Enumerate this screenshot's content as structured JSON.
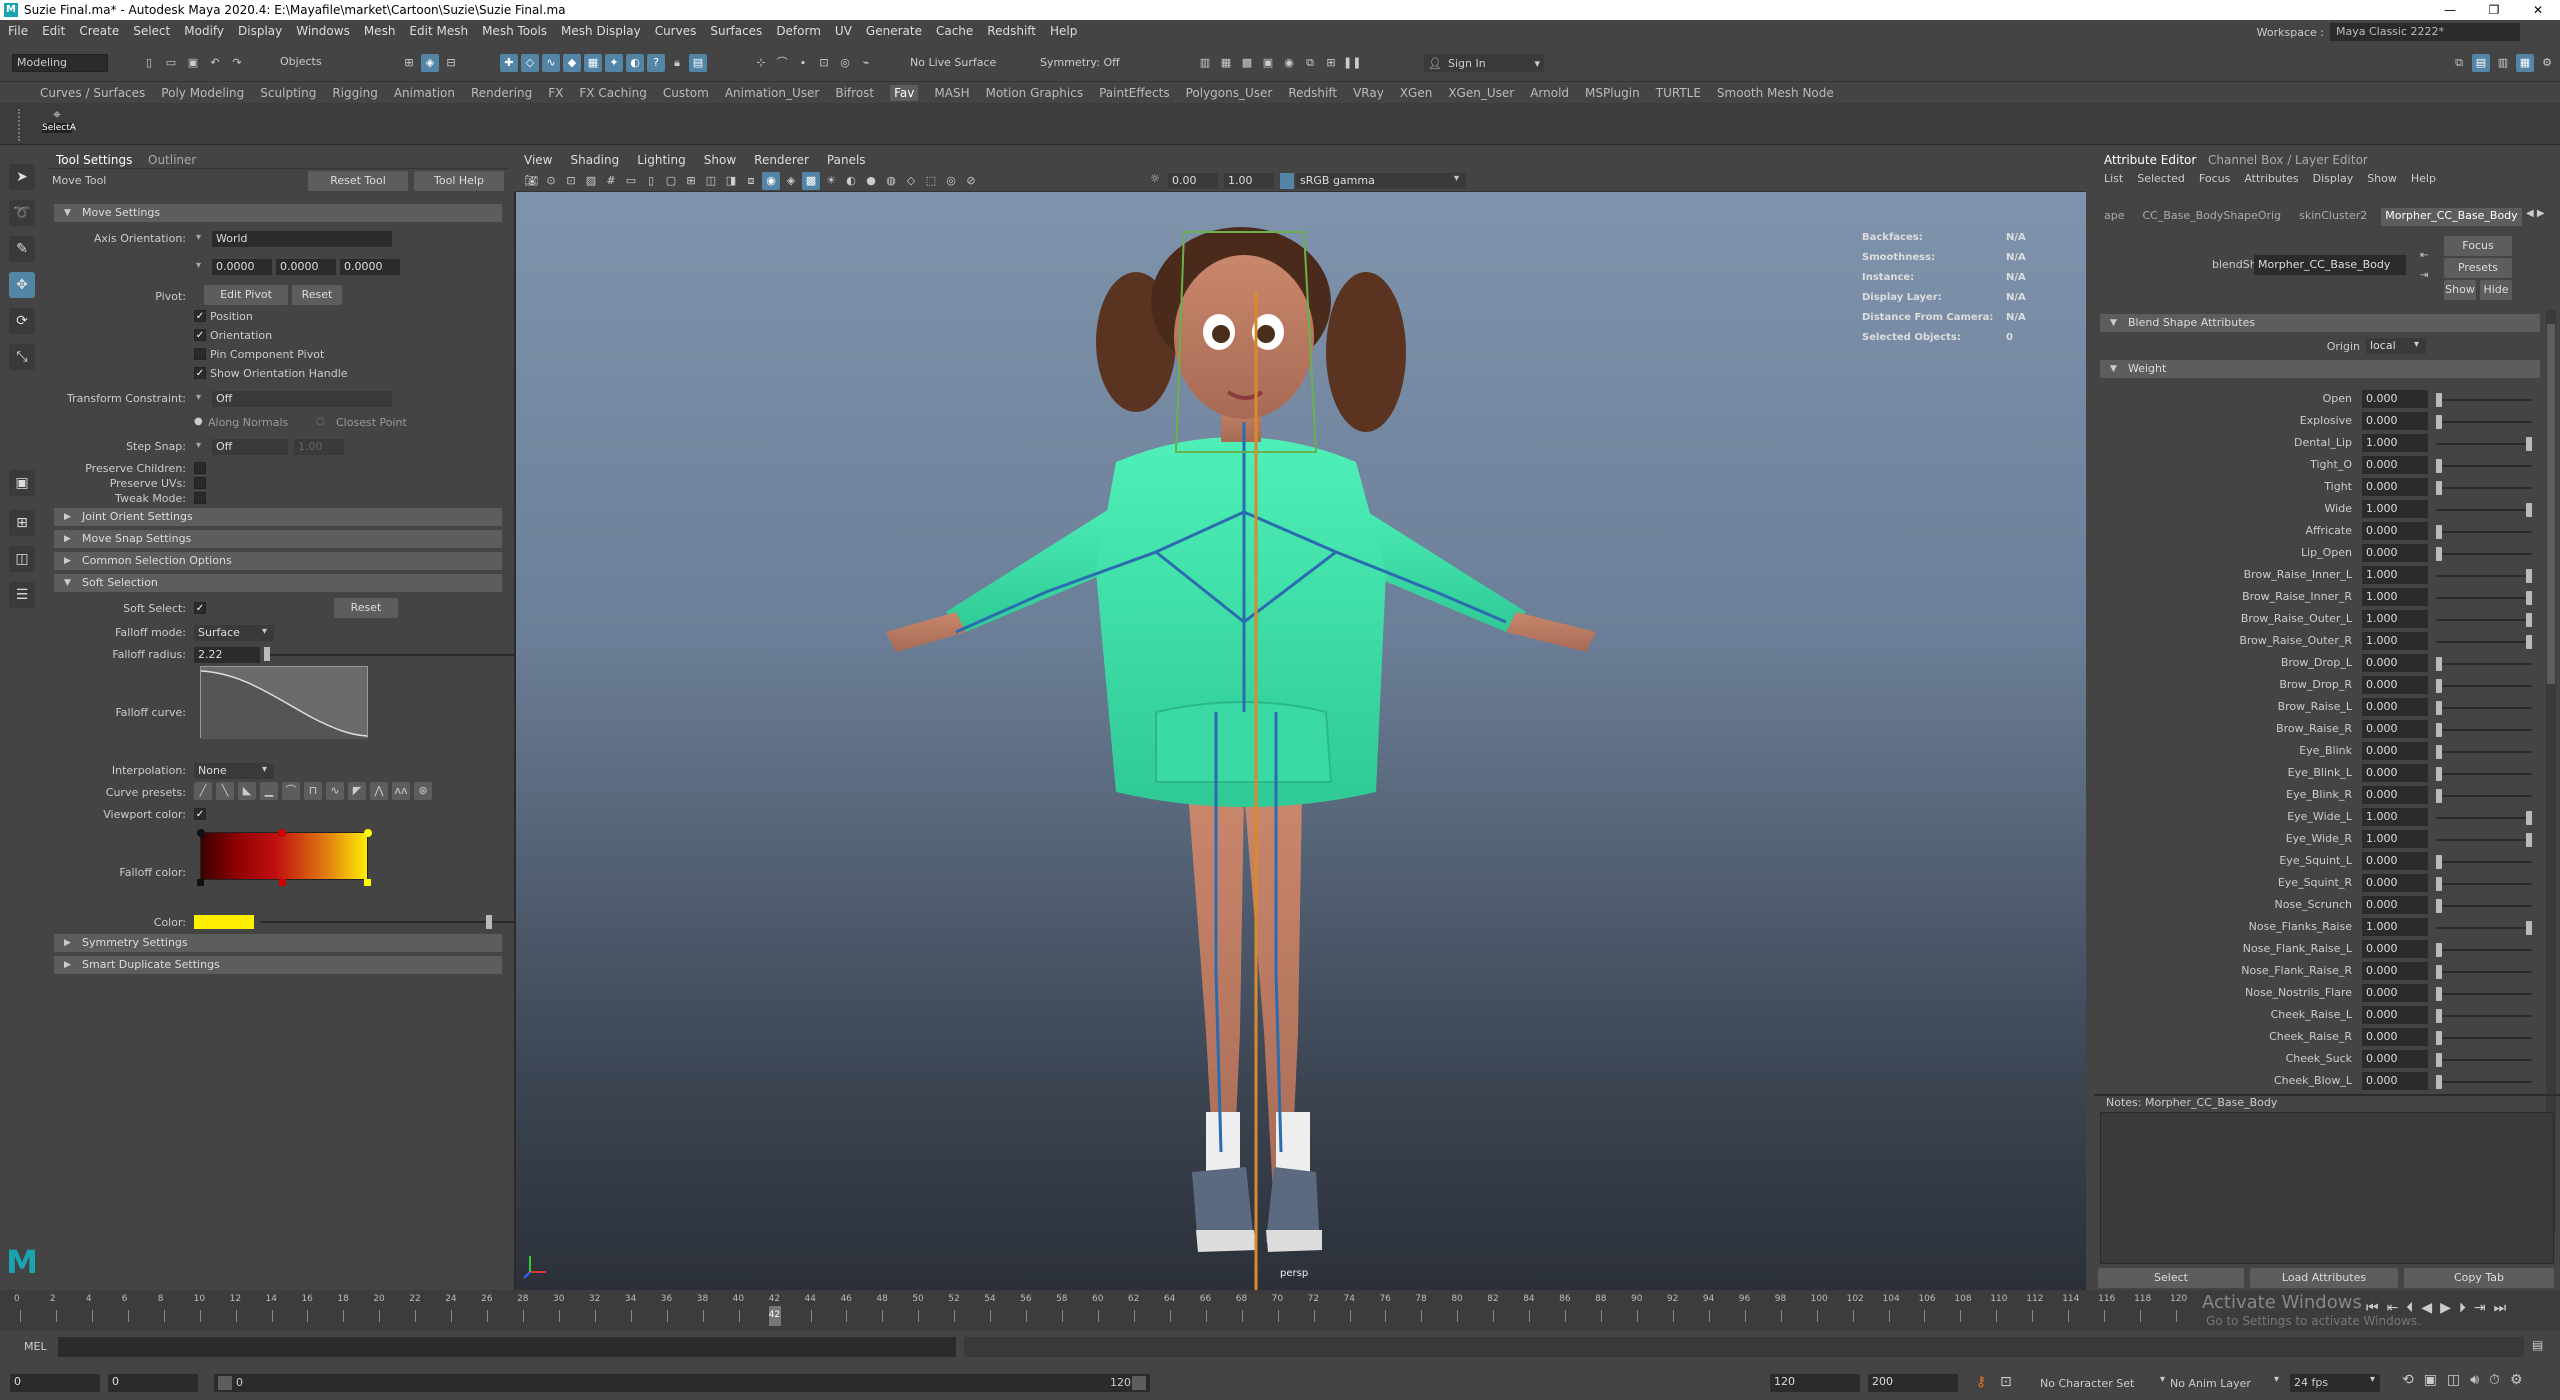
{
  "titlebar": {
    "title": "Suzie Final.ma* - Autodesk Maya 2020.4: E:\\Mayafile\\market\\Cartoon\\Suzie\\Suzie Final.ma",
    "minimize": "—",
    "maximize": "❐",
    "close": "✕"
  },
  "menus": [
    "File",
    "Edit",
    "Create",
    "Select",
    "Modify",
    "Display",
    "Windows",
    "Mesh",
    "Edit Mesh",
    "Mesh Tools",
    "Mesh Display",
    "Curves",
    "Surfaces",
    "Deform",
    "UV",
    "Generate",
    "Cache",
    "Redshift",
    "Help"
  ],
  "workspace": {
    "label": "Workspace :",
    "value": "Maya Classic 2222*"
  },
  "statusline": {
    "mode": "Modeling",
    "objects": "Objects",
    "live_surface": "No Live Surface",
    "symmetry": "Symmetry: Off",
    "sign_in": "Sign In"
  },
  "shelf_tabs": [
    "Curves / Surfaces",
    "Poly Modeling",
    "Sculpting",
    "Rigging",
    "Animation",
    "Rendering",
    "FX",
    "FX Caching",
    "Custom",
    "Animation_User",
    "Bifrost",
    "Fav",
    "MASH",
    "Motion Graphics",
    "PaintEffects",
    "Polygons_User",
    "Redshift",
    "VRay",
    "XGen",
    "XGen_User",
    "Arnold",
    "MSPlugin",
    "TURTLE",
    "Smooth Mesh Node"
  ],
  "shelf_active": "Fav",
  "shelf_item": "SelectA",
  "toolpanel": {
    "tabs": [
      "Tool Settings",
      "Outliner"
    ],
    "tool_name": "Move Tool",
    "reset_tool": "Reset Tool",
    "tool_help": "Tool Help",
    "move_settings": "Move Settings",
    "axis_orientation_label": "Axis Orientation:",
    "axis_orientation": "World",
    "axis_values": [
      "0.0000",
      "0.0000",
      "0.0000"
    ],
    "pivot_label": "Pivot:",
    "edit_pivot": "Edit Pivot",
    "reset": "Reset",
    "position": "Position",
    "orientation": "Orientation",
    "pin_component_pivot": "Pin Component Pivot",
    "show_orientation_handle": "Show Orientation Handle",
    "transform_constraint_label": "Transform Constraint:",
    "transform_constraint": "Off",
    "along_normals": "Along Normals",
    "closest_point": "Closest Point",
    "step_snap_label": "Step Snap:",
    "step_snap": "Off",
    "step_snap_value": "1.00",
    "preserve_children": "Preserve Children:",
    "preserve_uvs": "Preserve UVs:",
    "tweak_mode": "Tweak Mode:",
    "joint_orient_settings": "Joint Orient Settings",
    "move_snap_settings": "Move Snap Settings",
    "common_selection_options": "Common Selection Options",
    "soft_selection": "Soft Selection",
    "soft_select_label": "Soft Select:",
    "soft_reset": "Reset",
    "falloff_mode_label": "Falloff mode:",
    "falloff_mode": "Surface",
    "falloff_radius_label": "Falloff radius:",
    "falloff_radius": "2.22",
    "falloff_curve_label": "Falloff curve:",
    "interpolation_label": "Interpolation:",
    "interpolation": "None",
    "curve_presets_label": "Curve presets:",
    "viewport_color_label": "Viewport color:",
    "falloff_color_label": "Falloff color:",
    "color_label": "Color:",
    "symmetry_settings": "Symmetry Settings",
    "smart_duplicate_settings": "Smart Duplicate Settings"
  },
  "viewport": {
    "menus": [
      "View",
      "Shading",
      "Lighting",
      "Show",
      "Renderer",
      "Panels"
    ],
    "exposure": "0.00",
    "gamma": "1.00",
    "color_space": "sRGB gamma",
    "camera": "persp",
    "hud": [
      {
        "k": "Backfaces:",
        "v": "N/A"
      },
      {
        "k": "Smoothness:",
        "v": "N/A"
      },
      {
        "k": "Instance:",
        "v": "N/A"
      },
      {
        "k": "Display Layer:",
        "v": "N/A"
      },
      {
        "k": "Distance From Camera:",
        "v": "N/A"
      },
      {
        "k": "Selected Objects:",
        "v": "0"
      }
    ]
  },
  "attr": {
    "tabs": [
      "Attribute Editor",
      "Channel Box / Layer Editor"
    ],
    "menus": [
      "List",
      "Selected",
      "Focus",
      "Attributes",
      "Display",
      "Show",
      "Help"
    ],
    "node_tabs": [
      "ape",
      "CC_Base_BodyShapeOrig",
      "skinCluster2",
      "Morpher_CC_Base_Body"
    ],
    "blendshape_label": "blendShape:",
    "blendshape": "Morpher_CC_Base_Body",
    "focus": "Focus",
    "presets": "Presets",
    "show": "Show",
    "hide": "Hide",
    "blend_shape_attributes": "Blend Shape Attributes",
    "origin_label": "Origin",
    "origin": "local",
    "weight": "Weight",
    "weights": [
      {
        "n": "Open",
        "v": "0.000",
        "f": 0
      },
      {
        "n": "Explosive",
        "v": "0.000",
        "f": 0
      },
      {
        "n": "Dental_Lip",
        "v": "1.000",
        "f": 1
      },
      {
        "n": "Tight_O",
        "v": "0.000",
        "f": 0
      },
      {
        "n": "Tight",
        "v": "0.000",
        "f": 0
      },
      {
        "n": "Wide",
        "v": "1.000",
        "f": 1
      },
      {
        "n": "Affricate",
        "v": "0.000",
        "f": 0
      },
      {
        "n": "Lip_Open",
        "v": "0.000",
        "f": 0
      },
      {
        "n": "Brow_Raise_Inner_L",
        "v": "1.000",
        "f": 1
      },
      {
        "n": "Brow_Raise_Inner_R",
        "v": "1.000",
        "f": 1
      },
      {
        "n": "Brow_Raise_Outer_L",
        "v": "1.000",
        "f": 1
      },
      {
        "n": "Brow_Raise_Outer_R",
        "v": "1.000",
        "f": 1
      },
      {
        "n": "Brow_Drop_L",
        "v": "0.000",
        "f": 0
      },
      {
        "n": "Brow_Drop_R",
        "v": "0.000",
        "f": 0
      },
      {
        "n": "Brow_Raise_L",
        "v": "0.000",
        "f": 0
      },
      {
        "n": "Brow_Raise_R",
        "v": "0.000",
        "f": 0
      },
      {
        "n": "Eye_Blink",
        "v": "0.000",
        "f": 0
      },
      {
        "n": "Eye_Blink_L",
        "v": "0.000",
        "f": 0
      },
      {
        "n": "Eye_Blink_R",
        "v": "0.000",
        "f": 0
      },
      {
        "n": "Eye_Wide_L",
        "v": "1.000",
        "f": 1
      },
      {
        "n": "Eye_Wide_R",
        "v": "1.000",
        "f": 1
      },
      {
        "n": "Eye_Squint_L",
        "v": "0.000",
        "f": 0
      },
      {
        "n": "Eye_Squint_R",
        "v": "0.000",
        "f": 0
      },
      {
        "n": "Nose_Scrunch",
        "v": "0.000",
        "f": 0
      },
      {
        "n": "Nose_Flanks_Raise",
        "v": "1.000",
        "f": 1
      },
      {
        "n": "Nose_Flank_Raise_L",
        "v": "0.000",
        "f": 0
      },
      {
        "n": "Nose_Flank_Raise_R",
        "v": "0.000",
        "f": 0
      },
      {
        "n": "Nose_Nostrils_Flare",
        "v": "0.000",
        "f": 0
      },
      {
        "n": "Cheek_Raise_L",
        "v": "0.000",
        "f": 0
      },
      {
        "n": "Cheek_Raise_R",
        "v": "0.000",
        "f": 0
      },
      {
        "n": "Cheek_Suck",
        "v": "0.000",
        "f": 0
      },
      {
        "n": "Cheek_Blow_L",
        "v": "0.000",
        "f": 0
      }
    ],
    "notes": "Notes:  Morpher_CC_Base_Body",
    "select": "Select",
    "load_attributes": "Load Attributes",
    "copy_tab": "Copy Tab"
  },
  "timeline": {
    "ticks": [
      "0",
      "2",
      "4",
      "6",
      "8",
      "10",
      "12",
      "14",
      "16",
      "18",
      "20",
      "22",
      "24",
      "26",
      "28",
      "30",
      "32",
      "34",
      "36",
      "38",
      "40",
      "42",
      "44",
      "46",
      "48",
      "50",
      "52",
      "54",
      "56",
      "58",
      "60",
      "62",
      "64",
      "66",
      "68",
      "70",
      "72",
      "74",
      "76",
      "78",
      "80",
      "82",
      "84",
      "86",
      "88",
      "90",
      "92",
      "94",
      "96",
      "98",
      "100",
      "102",
      "104",
      "106",
      "108",
      "110",
      "112",
      "114",
      "116",
      "118",
      "120"
    ],
    "current": "42",
    "activate_windows": "Activate Windows",
    "activate_sub": "Go to Settings to activate Windows."
  },
  "cmdline": {
    "label": "MEL"
  },
  "rangebar": {
    "start": "0",
    "start2": "0",
    "range_start": "0",
    "range_end": "120",
    "end": "120",
    "end2": "200",
    "character_set": "No Character Set",
    "anim_layer": "No Anim Layer",
    "fps": "24 fps"
  },
  "colors": {
    "accent": "#5285a6",
    "hoodie": "#3ddba8",
    "falloff_yellow": "#ffee00",
    "falloff_red": "#8b0000"
  }
}
